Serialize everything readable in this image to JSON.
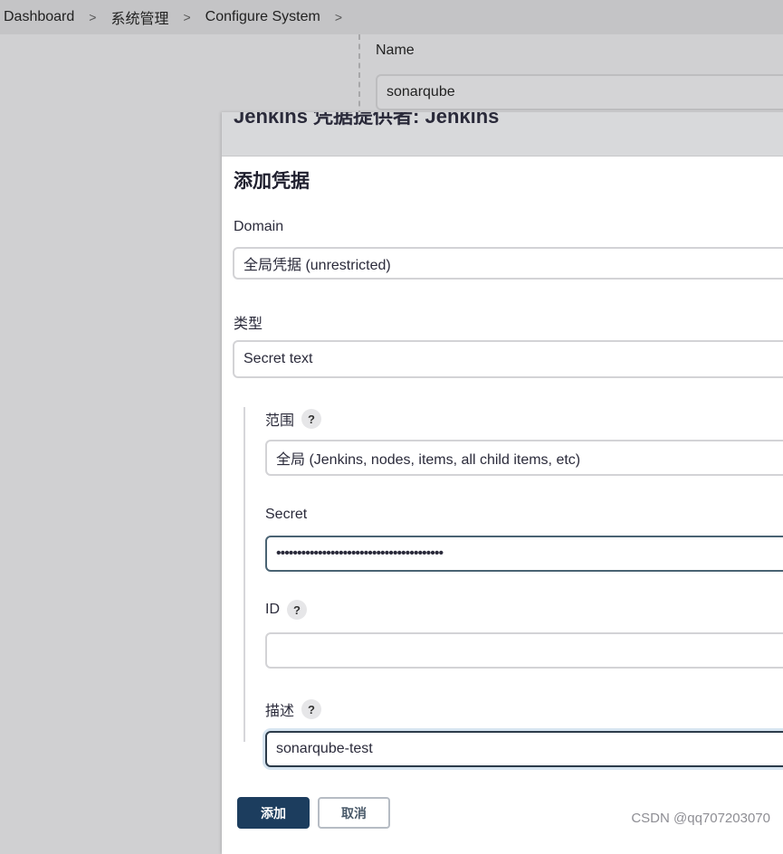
{
  "breadcrumb": {
    "items": [
      "Dashboard",
      "系统管理",
      "Configure System"
    ],
    "separator": ">"
  },
  "background_form": {
    "name_label": "Name",
    "name_value": "sonarqube"
  },
  "dialog": {
    "title": "Jenkins 凭据提供者: Jenkins",
    "section_title": "添加凭据",
    "domain": {
      "label": "Domain",
      "value": "全局凭据 (unrestricted)"
    },
    "kind": {
      "label": "类型",
      "value": "Secret text"
    },
    "scope": {
      "label": "范围",
      "value": "全局 (Jenkins, nodes, items, all child items, etc)"
    },
    "secret": {
      "label": "Secret",
      "value": "••••••••••••••••••••••••••••••••••••••••"
    },
    "id": {
      "label": "ID",
      "value": ""
    },
    "description": {
      "label": "描述",
      "value": "sonarqube-test"
    },
    "help_glyph": "?",
    "buttons": {
      "add": "添加",
      "cancel": "取消"
    }
  },
  "watermark": "CSDN @qq707203070",
  "colors": {
    "primary_button": "#1c3d5e",
    "focus_border": "#2c3b4a",
    "page_bg": "#d0d0d2"
  }
}
